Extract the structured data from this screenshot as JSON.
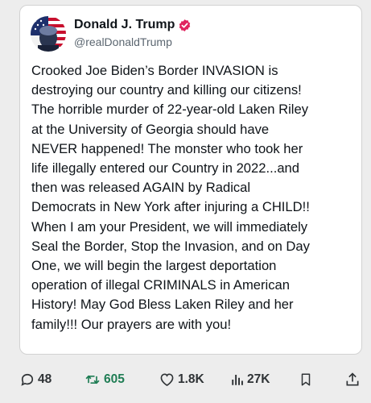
{
  "author": {
    "name": "Donald J. Trump",
    "handle": "@realDonaldTrump",
    "verified_badge_icon": "verified-badge-icon",
    "badge_color": "#e0245e"
  },
  "tweet": {
    "lines": [
      "Crooked Joe Biden’s Border INVASION is",
      "destroying our country and killing our citizens!",
      "The horrible murder of 22-year-old Laken Riley",
      "at the University of Georgia should have",
      "NEVER happened! The monster who took her",
      "life illegally entered our Country in 2022...and",
      "then was released AGAIN by Radical",
      "Democrats in New York after injuring a CHILD!!",
      "When I am your President, we will immediately",
      "Seal the Border, Stop the Invasion, and on Day",
      "One, we will begin the largest deportation",
      "operation of illegal CRIMINALS in American",
      "History! May God Bless Laken Riley and her",
      "family!!! Our prayers are with you!"
    ]
  },
  "actions": {
    "replies": "48",
    "reposts": "605",
    "likes": "1.8K",
    "views": "27K",
    "icons": [
      "reply-icon",
      "repost-icon",
      "like-icon",
      "views-icon",
      "bookmark-icon",
      "share-icon"
    ],
    "repost_color": "#1f7d54",
    "icon_color": "#2f3336"
  }
}
